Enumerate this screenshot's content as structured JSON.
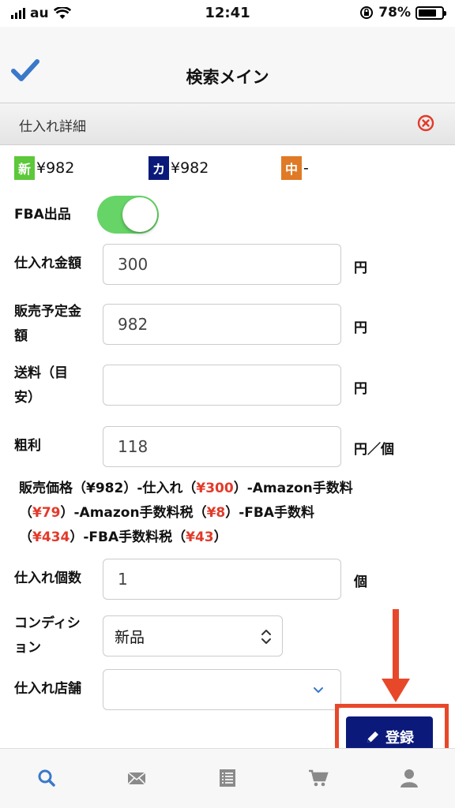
{
  "status_bar": {
    "carrier": "au",
    "time": "12:41",
    "battery": "78%",
    "battery_level": 0.78
  },
  "nav": {
    "title": "検索メイン",
    "check_icon": "check-icon",
    "accent_color": "#3a78c9"
  },
  "panel": {
    "title": "仕入れ詳細",
    "close_icon": "close-circle-icon"
  },
  "prices": [
    {
      "badge": "新",
      "badge_color": "#5cc83a",
      "value": "¥982"
    },
    {
      "badge": "カ",
      "badge_color": "#0b1a7a",
      "value": "¥982"
    },
    {
      "badge": "中",
      "badge_color": "#e07a26",
      "value": "-"
    }
  ],
  "fba": {
    "label": "FBA出品",
    "on": true
  },
  "fields": {
    "purchase_price": {
      "label": "仕入れ金額",
      "value": "300",
      "unit": "円"
    },
    "planned_sale": {
      "label_line1": "販売予定金",
      "label_line2": "額",
      "value": "982",
      "unit": "円"
    },
    "shipping": {
      "label_line1": "送料（目",
      "label_line2": "安）",
      "value": "",
      "unit": "円"
    },
    "gross_profit": {
      "label": "粗利",
      "value": "118",
      "unit": "円／個"
    },
    "quantity": {
      "label": "仕入れ個数",
      "value": "1",
      "unit": "個"
    },
    "condition": {
      "label_line1": "コンディシ",
      "label_line2": "ョン",
      "value": "新品"
    },
    "store": {
      "label": "仕入れ店舗",
      "value": ""
    }
  },
  "formula": {
    "p1": "販売価格（¥982）-仕入れ（",
    "v1": "¥300",
    "p2": "）-Amazon手数料",
    "p3": "（",
    "v2": "¥79",
    "p4": "）-Amazon手数料税（",
    "v3": "¥8",
    "p5": "）-FBA手数料",
    "p6": "（",
    "v4": "¥434",
    "p7": "）-FBA手数料税（",
    "v5": "¥43",
    "p8": "）"
  },
  "register_button": {
    "label": "登録",
    "icon": "pencil-icon",
    "color": "#0b1a7a"
  },
  "annotation": {
    "color": "#e8482a"
  },
  "tabs": [
    {
      "icon": "search-icon",
      "active": true
    },
    {
      "icon": "mail-icon",
      "active": false
    },
    {
      "icon": "list-icon",
      "active": false
    },
    {
      "icon": "cart-icon",
      "active": false
    },
    {
      "icon": "user-icon",
      "active": false
    }
  ]
}
